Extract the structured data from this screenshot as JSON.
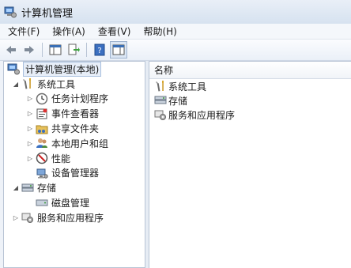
{
  "window": {
    "title": "计算机管理"
  },
  "menu": [
    "文件(F)",
    "操作(A)",
    "查看(V)",
    "帮助(H)"
  ],
  "tree": {
    "root": "计算机管理(本地)",
    "system_tools": {
      "label": "系统工具",
      "children": [
        "任务计划程序",
        "事件查看器",
        "共享文件夹",
        "本地用户和组",
        "性能",
        "设备管理器"
      ]
    },
    "storage": {
      "label": "存储",
      "children": [
        "磁盘管理"
      ]
    },
    "services": {
      "label": "服务和应用程序"
    }
  },
  "list": {
    "column": "名称",
    "items": [
      "系统工具",
      "存储",
      "服务和应用程序"
    ]
  },
  "icons": {
    "app": "computer-management-icon",
    "back": "back-arrow-icon",
    "forward": "forward-arrow-icon",
    "show-tree": "show-hide-tree-icon",
    "export": "export-list-icon",
    "help": "help-icon",
    "action-pane": "action-pane-icon"
  }
}
